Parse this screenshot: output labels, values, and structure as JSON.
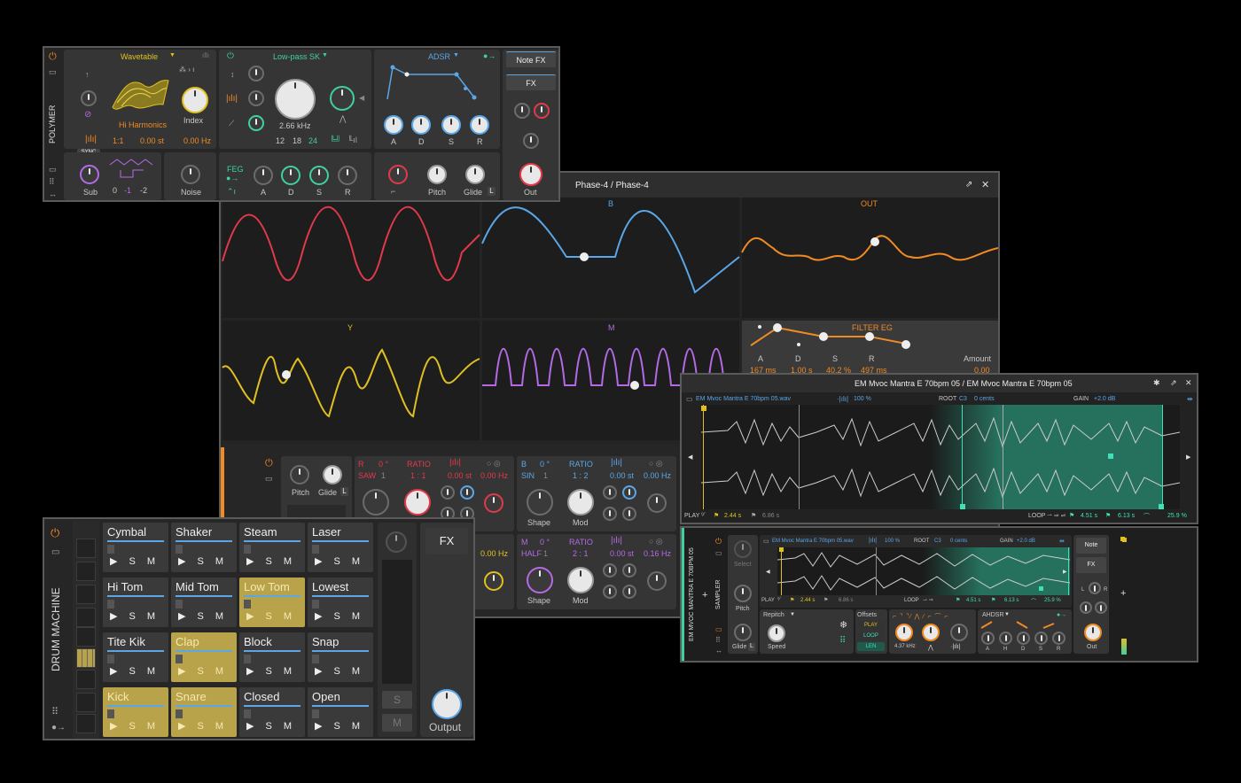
{
  "polymer": {
    "device_name": "POLYMER",
    "osc_type": "Wavetable",
    "wavetable_name": "Hi Harmonics",
    "index_label": "Index",
    "ratio": "1:1",
    "detune": "0.00 st",
    "freq_offset": "0.00 Hz",
    "sync_label": "SYNC",
    "sub_label": "Sub",
    "octaves": [
      "0",
      "-1",
      "-2"
    ],
    "noise_label": "Noise",
    "filter_type": "Low-pass SK",
    "cutoff": "2.66 kHz",
    "slopes": [
      "12",
      "18",
      "24"
    ],
    "env_type": "ADSR",
    "env_knobs": [
      "A",
      "D",
      "S",
      "R"
    ],
    "feg_label": "FEG",
    "feg_knobs": [
      "A",
      "D",
      "S",
      "R"
    ],
    "pitch_label": "Pitch",
    "glide_label": "Glide",
    "glide_badge": "L",
    "note_fx": "Note FX",
    "fx": "FX",
    "out_label": "Out"
  },
  "phase4": {
    "title": "Phase-4 / Phase-4",
    "scopes": [
      "B",
      "OUT",
      "Y",
      "M"
    ],
    "filter_eg": {
      "title": "FILTER EG",
      "headers": [
        "A",
        "D",
        "S",
        "R",
        "Amount"
      ],
      "values": [
        "167 ms",
        "1.00 s",
        "40.2 %",
        "497 ms",
        "0.00"
      ]
    },
    "osc_rows": [
      {
        "name": "R",
        "phase": "0 °",
        "ratio_label": "RATIO",
        "wave": "SAW",
        "wave_num": "1",
        "ratio": "1 : 1",
        "st": "0.00 st",
        "hz": "0.00 Hz"
      },
      {
        "name": "B",
        "phase": "0 °",
        "ratio_label": "RATIO",
        "wave": "SIN",
        "wave_num": "1",
        "ratio": "1 : 2",
        "st": "0.00 st",
        "hz": "0.00 Hz"
      },
      {
        "name": "M",
        "phase": "0 °",
        "ratio_label": "RATIO",
        "wave": "HALF",
        "wave_num": "1",
        "ratio": "2 : 1",
        "st": "0.00 st",
        "hz": "0.16 Hz"
      }
    ],
    "hidden_hz": "0.00 Hz",
    "pitch_label": "Pitch",
    "glide_label": "Glide",
    "glide_badge": "L",
    "shape_label": "Shape",
    "mod_label": "Mod"
  },
  "sampler_window": {
    "title": "EM Mvoc Mantra E 70bpm 05 / EM Mvoc Mantra E 70bpm 05",
    "file": "EM Mvoc Mantra E 70bpm 05.wav",
    "speed": "100 %",
    "root_label": "ROOT",
    "root": "C3",
    "cents": "0 cents",
    "gain_label": "GAIN",
    "gain": "+2.0 dB",
    "play_label": "PLAY",
    "play_start": "2.44 s",
    "play_end": "6.86 s",
    "loop_label": "LOOP",
    "loop_start": "4.51 s",
    "loop_end": "6.13 s",
    "loop_xfade": "25.9 %"
  },
  "sampler_device": {
    "track_name": "EM MVOC MANTRA E 70BPM 05",
    "device_name": "SAMPLER",
    "select_label": "Select",
    "pitch_label": "Pitch",
    "glide_label": "Glide",
    "glide_badge": "L",
    "file": "EM Mvoc Mantra E 70bpm 05.wav",
    "speed": "100 %",
    "root_label": "ROOT",
    "root": "C3",
    "cents": "0 cents",
    "gain_label": "GAIN",
    "gain": "+2.0 dB",
    "play_label": "PLAY",
    "play_start": "2.44 s",
    "play_end": "6.86 s",
    "loop_label": "LOOP",
    "loop_start": "4.51 s",
    "loop_end": "6.13 s",
    "loop_xfade": "25.9 %",
    "mode": "Repitch",
    "speed_label": "Speed",
    "offsets_label": "Offsets",
    "offsets": [
      "PLAY",
      "LOOP",
      "LEN"
    ],
    "cutoff": "4.37 kHz",
    "env_type": "AHDSR",
    "env_knobs": [
      "A",
      "H",
      "D",
      "S",
      "R"
    ],
    "note": "Note",
    "fx": "FX",
    "lr": [
      "L",
      "R"
    ],
    "out_label": "Out"
  },
  "drum_machine": {
    "device_name": "DRUM MACHINE",
    "pads": [
      {
        "name": "Cymbal",
        "active": false
      },
      {
        "name": "Shaker",
        "active": false
      },
      {
        "name": "Steam",
        "active": false
      },
      {
        "name": "Laser",
        "active": false
      },
      {
        "name": "Hi Tom",
        "active": false
      },
      {
        "name": "Mid Tom",
        "active": false
      },
      {
        "name": "Low Tom",
        "active": true
      },
      {
        "name": "Lowest",
        "active": false
      },
      {
        "name": "Tite Kik",
        "active": false
      },
      {
        "name": "Clap",
        "active": true
      },
      {
        "name": "Block",
        "active": false
      },
      {
        "name": "Snap",
        "active": false
      },
      {
        "name": "Kick",
        "active": true
      },
      {
        "name": "Snare",
        "active": true
      },
      {
        "name": "Closed",
        "active": false
      },
      {
        "name": "Open",
        "active": false
      }
    ],
    "pad_controls": "▶ S M",
    "solo": "S",
    "mute": "M",
    "fx": "FX",
    "output_label": "Output"
  },
  "colors": {
    "accent_orange": "#f08a24",
    "accent_blue": "#5aa6e6",
    "accent_green": "#3fd0a0",
    "accent_yellow": "#e0c020",
    "accent_purple": "#b46ae6",
    "accent_red": "#e03a4a",
    "sample_teal": "#2fb894"
  }
}
